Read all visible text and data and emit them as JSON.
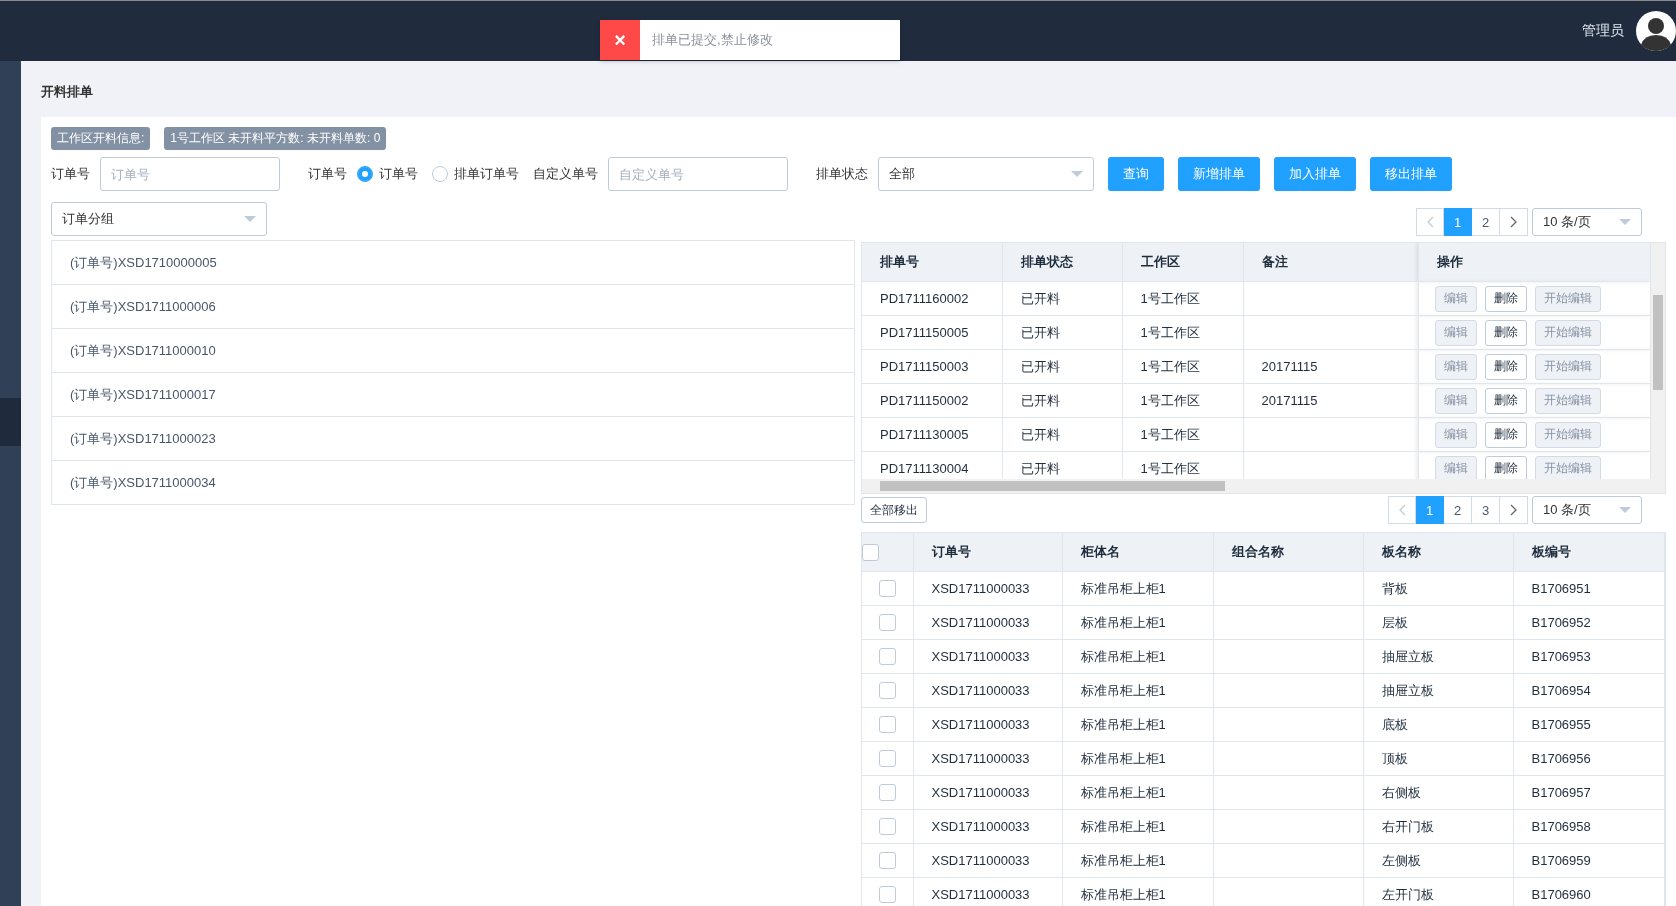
{
  "header": {
    "user": "管理员"
  },
  "toast": {
    "icon": "×",
    "text": "排单已提交,禁止修改"
  },
  "page_title": "开料排单",
  "info_tags": [
    "工作区开料信息:",
    "1号工作区 未开料平方数: 未开料单数: 0"
  ],
  "filters": {
    "order_label": "订单号",
    "order_placeholder": "订单号",
    "type_label": "订单号",
    "radios": [
      {
        "label": "订单号",
        "selected": true
      },
      {
        "label": "排单订单号",
        "selected": false
      }
    ],
    "custom_label": "自定义单号",
    "custom_placeholder": "自定义单号",
    "status_label": "排单状态",
    "status_value": "全部",
    "buttons": [
      "查询",
      "新增排单",
      "加入排单",
      "移出排单"
    ]
  },
  "group_select": "订单分组",
  "order_groups": [
    "(订单号)XSD1710000005",
    "(订单号)XSD1711000006",
    "(订单号)XSD1711000010",
    "(订单号)XSD1711000017",
    "(订单号)XSD1711000023",
    "(订单号)XSD1711000034"
  ],
  "schedule_pagination": {
    "pages": [
      {
        "label": "1",
        "selected": true
      },
      {
        "label": "2",
        "selected": false
      }
    ],
    "page_size": "10 条/页"
  },
  "schedule_table": {
    "columns": [
      "排单号",
      "排单状态",
      "工作区",
      "备注",
      "操作"
    ],
    "rows": [
      {
        "cells": [
          "PD1711160002",
          "已开料",
          "1号工作区",
          ""
        ],
        "actions": [
          {
            "label": "编辑",
            "disabled": true
          },
          {
            "label": "删除",
            "disabled": false
          },
          {
            "label": "开始编辑",
            "disabled": true
          }
        ]
      },
      {
        "cells": [
          "PD1711150005",
          "已开料",
          "1号工作区",
          ""
        ],
        "actions": [
          {
            "label": "编辑",
            "disabled": true
          },
          {
            "label": "删除",
            "disabled": false
          },
          {
            "label": "开始编辑",
            "disabled": true
          }
        ]
      },
      {
        "cells": [
          "PD1711150003",
          "已开料",
          "1号工作区",
          "20171115"
        ],
        "actions": [
          {
            "label": "编辑",
            "disabled": true
          },
          {
            "label": "删除",
            "disabled": false
          },
          {
            "label": "开始编辑",
            "disabled": true
          }
        ]
      },
      {
        "cells": [
          "PD1711150002",
          "已开料",
          "1号工作区",
          "20171115"
        ],
        "actions": [
          {
            "label": "编辑",
            "disabled": true
          },
          {
            "label": "删除",
            "disabled": false
          },
          {
            "label": "开始编辑",
            "disabled": true
          }
        ]
      },
      {
        "cells": [
          "PD1711130005",
          "已开料",
          "1号工作区",
          ""
        ],
        "actions": [
          {
            "label": "编辑",
            "disabled": true
          },
          {
            "label": "删除",
            "disabled": false
          },
          {
            "label": "开始编辑",
            "disabled": true
          }
        ]
      },
      {
        "cells": [
          "PD1711130004",
          "已开料",
          "1号工作区",
          ""
        ],
        "actions": [
          {
            "label": "编辑",
            "disabled": true
          },
          {
            "label": "删除",
            "disabled": false
          },
          {
            "label": "开始编辑",
            "disabled": true
          }
        ]
      }
    ]
  },
  "remove_all": "全部移出",
  "parts_pagination": {
    "pages": [
      {
        "label": "1",
        "selected": true
      },
      {
        "label": "2",
        "selected": false
      },
      {
        "label": "3",
        "selected": false
      }
    ],
    "page_size": "10 条/页"
  },
  "parts_table": {
    "all_checked": false,
    "columns": [
      "订单号",
      "柜体名",
      "组合名称",
      "板名称",
      "板编号"
    ],
    "rows": [
      {
        "checked": false,
        "cells": [
          "XSD1711000033",
          "标准吊柜上柜1",
          "",
          "背板",
          "B1706951"
        ]
      },
      {
        "checked": false,
        "cells": [
          "XSD1711000033",
          "标准吊柜上柜1",
          "",
          "层板",
          "B1706952"
        ]
      },
      {
        "checked": false,
        "cells": [
          "XSD1711000033",
          "标准吊柜上柜1",
          "",
          "抽屉立板",
          "B1706953"
        ]
      },
      {
        "checked": false,
        "cells": [
          "XSD1711000033",
          "标准吊柜上柜1",
          "",
          "抽屉立板",
          "B1706954"
        ]
      },
      {
        "checked": false,
        "cells": [
          "XSD1711000033",
          "标准吊柜上柜1",
          "",
          "底板",
          "B1706955"
        ]
      },
      {
        "checked": false,
        "cells": [
          "XSD1711000033",
          "标准吊柜上柜1",
          "",
          "顶板",
          "B1706956"
        ]
      },
      {
        "checked": false,
        "cells": [
          "XSD1711000033",
          "标准吊柜上柜1",
          "",
          "右侧板",
          "B1706957"
        ]
      },
      {
        "checked": false,
        "cells": [
          "XSD1711000033",
          "标准吊柜上柜1",
          "",
          "右开门板",
          "B1706958"
        ]
      },
      {
        "checked": false,
        "cells": [
          "XSD1711000033",
          "标准吊柜上柜1",
          "",
          "左侧板",
          "B1706959"
        ]
      },
      {
        "checked": false,
        "cells": [
          "XSD1711000033",
          "标准吊柜上柜1",
          "",
          "左开门板",
          "B1706960"
        ]
      }
    ]
  }
}
